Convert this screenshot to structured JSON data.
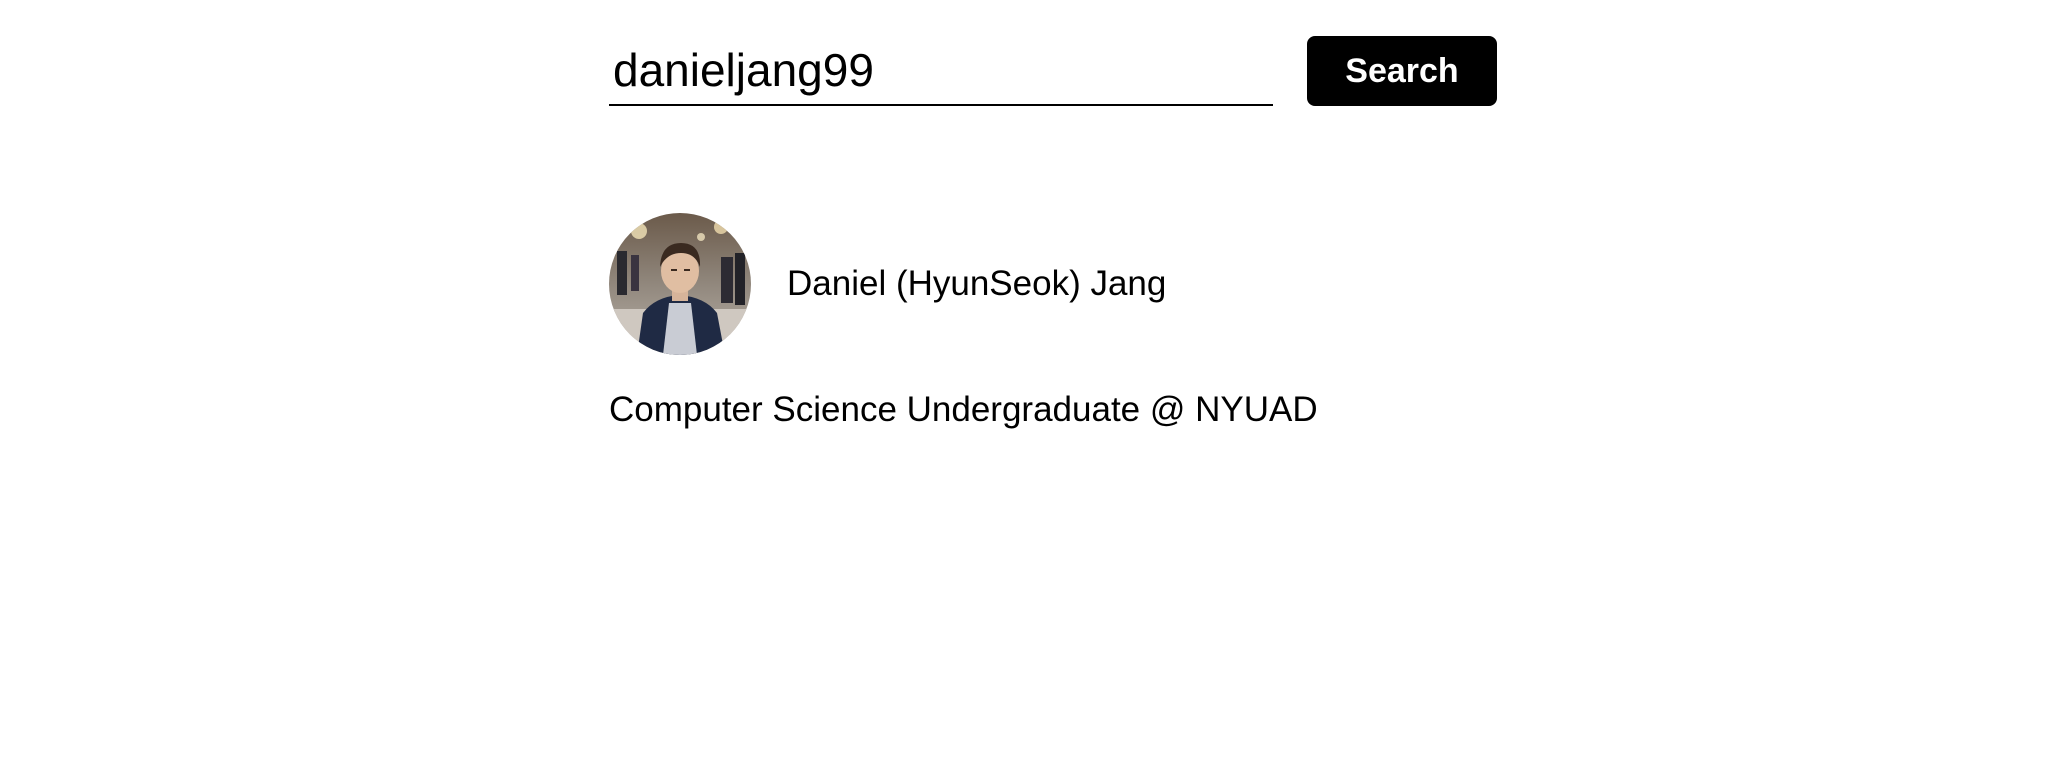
{
  "search": {
    "value": "danieljang99",
    "button_label": "Search"
  },
  "profile": {
    "name": "Daniel (HyunSeok) Jang",
    "bio": "Computer Science Undergraduate @ NYUAD"
  },
  "colors": {
    "background": "#ffffff",
    "text": "#000000",
    "button_bg": "#000000",
    "button_text": "#ffffff"
  }
}
